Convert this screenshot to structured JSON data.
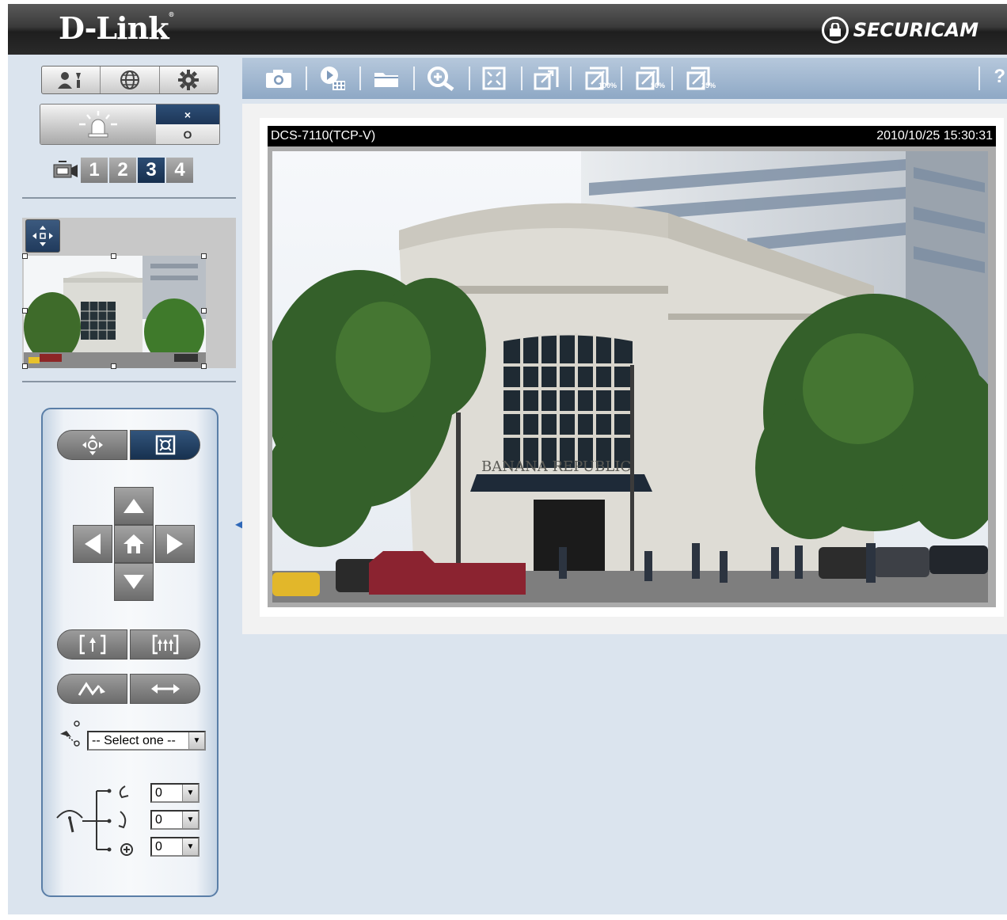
{
  "header": {
    "logo": "D-Link",
    "brand": "SECURICAM"
  },
  "sidebar": {
    "top_buttons": [
      "user-settings-icon",
      "globe-icon",
      "gear-icon"
    ],
    "alarm": {
      "x_label": "×",
      "o_label": "O"
    },
    "channels": [
      "1",
      "2",
      "3",
      "4"
    ],
    "active_channel": "3",
    "ptz": {
      "preset_select": "-- Select one --",
      "speed_pan": "0",
      "speed_tilt": "0",
      "speed_zoom": "0"
    }
  },
  "toolbar": {
    "zoom_100": "100%",
    "zoom_50": "50%",
    "zoom_25": "25%",
    "help": "?"
  },
  "video": {
    "camera_name": "DCS-7110(TCP-V)",
    "timestamp": "2010/10/25 15:30:31",
    "sign_text": "BANANA REPUBLIC"
  },
  "colors": {
    "header_dark": "#1e1e1e",
    "panel_bg": "#dbe4ee",
    "active_blue": "#1d3657",
    "toolbar_blue": "#9fb6cf"
  }
}
